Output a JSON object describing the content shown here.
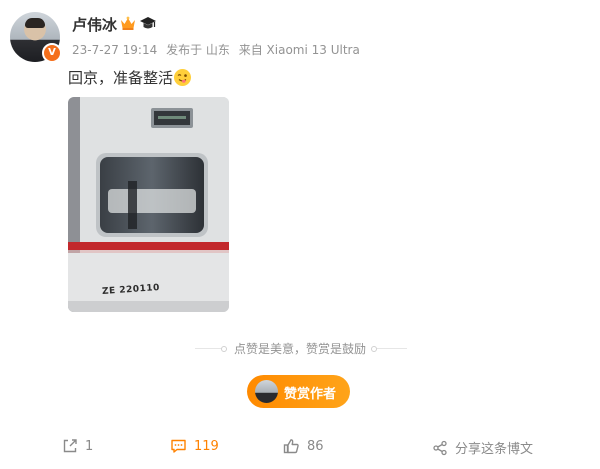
{
  "author": {
    "name": "卢伟冰",
    "badge_letter": "V",
    "icons": [
      "crown-icon",
      "graduation-cap-icon"
    ]
  },
  "meta": {
    "date": "23-7-27 19:14",
    "location": "发布于 山东",
    "source": "来自 Xiaomi 13 Ultra"
  },
  "post": {
    "text": "回京，准备整活",
    "emoji": "wink-tongue-emoji",
    "photo_caption": "ZE 220110"
  },
  "divider_text": "点赞是美意，赞赏是鼓励",
  "tip_button": {
    "label": "赞赏作者"
  },
  "actions": {
    "repost": {
      "count": "1",
      "icon": "share-out-icon"
    },
    "comment": {
      "count": "119",
      "icon": "comment-icon",
      "color": "#ff8200"
    },
    "like": {
      "count": "86",
      "icon": "thumbs-up-icon"
    },
    "share": {
      "label": "分享这条博文",
      "icon": "share-nodes-icon"
    }
  },
  "colors": {
    "accent": "#ff8200",
    "meta": "#939393",
    "text": "#333333"
  }
}
